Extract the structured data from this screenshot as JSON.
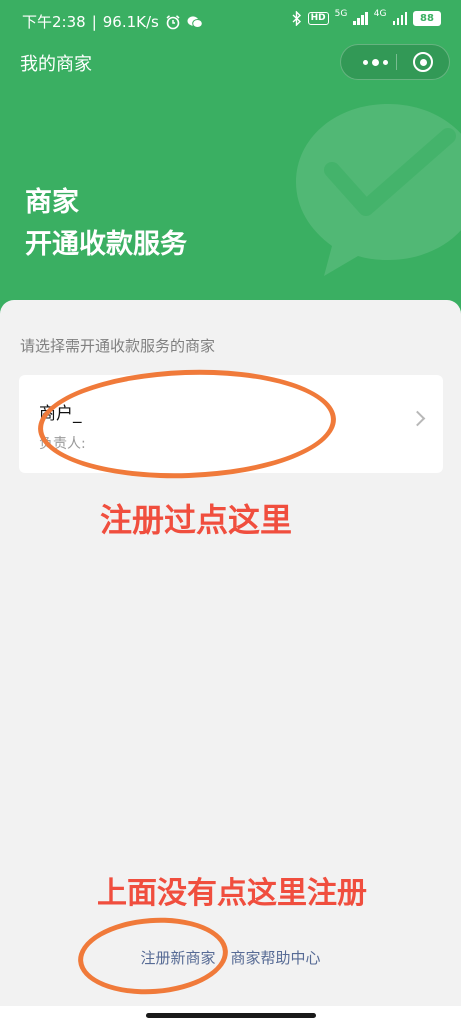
{
  "status_bar": {
    "time": "下午2:38",
    "speed": "96.1K/s",
    "hd": "HD",
    "net1": "5G",
    "net2": "4G",
    "battery": "88"
  },
  "nav": {
    "title": "我的商家"
  },
  "hero": {
    "line1": "商家",
    "line2": "开通收款服务"
  },
  "content": {
    "select_hint": "请选择需开通收款服务的商家",
    "merchant": {
      "name": "商户_",
      "owner_label": "负责人:"
    }
  },
  "annotations": {
    "tip_registered": "注册过点这里",
    "tip_register_new": "上面没有点这里注册"
  },
  "footer": {
    "register_link": "注册新商家",
    "help_link": "商家帮助中心"
  },
  "colors": {
    "header_green": "#3aaf62",
    "link_blue": "#576b95",
    "annotation_red": "#f04e3e",
    "annotation_orange": "#f07a3a"
  }
}
